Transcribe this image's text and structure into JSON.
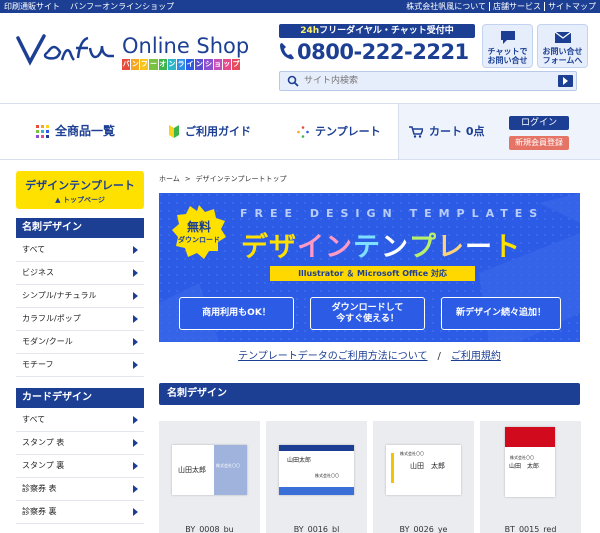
{
  "topbar": {
    "left": [
      "印刷通販サイト",
      "バンフーオンラインショップ"
    ],
    "right": [
      "株式会社帆風について",
      "店舗サービス",
      "サイトマップ"
    ]
  },
  "header": {
    "logo_text": "Vanfu",
    "shop_title": "Online Shop",
    "shop_sub": [
      "バ",
      "ン",
      "フ",
      "ー",
      "オ",
      "ン",
      "ラ",
      "イ",
      "ン",
      "シ",
      "ョ",
      "ッ",
      "プ"
    ],
    "phone_label_highlight": "24h",
    "phone_label_rest": "フリーダイヤル・チャット受付中",
    "phone_number": "0800-222-2221",
    "chat_button": "チャットで\nお問い合せ",
    "form_button": "お問い合せ\nフォームへ",
    "search_placeholder": "サイト内検索"
  },
  "nav": {
    "all_products": "全商品一覧",
    "guide": "ご利用ガイド",
    "template": "テンプレート",
    "cart": "カート 0点",
    "login": "ログイン",
    "register": "新規会員登録"
  },
  "sidebar": {
    "top_button_line1": "デザインテンプレート",
    "top_button_line2": "トップページ",
    "sections": [
      {
        "title": "名刺デザイン",
        "items": [
          "すべて",
          "ビジネス",
          "シンプル/ナチュラル",
          "カラフル/ポップ",
          "モダン/クール",
          "モチーフ"
        ]
      },
      {
        "title": "カードデザイン",
        "items": [
          "すべて",
          "スタンプ 表",
          "スタンプ 裏",
          "診察券 表",
          "診察券 裏"
        ]
      }
    ]
  },
  "main": {
    "breadcrumb": [
      "ホーム",
      "デザインテンプレートトップ"
    ],
    "hero": {
      "badge_line1": "無料",
      "badge_line2": "ダウンロード",
      "free_text": "FREE DESIGN TEMPLATES",
      "title_chars": [
        "デ",
        "ザ",
        "イ",
        "ン",
        "テ",
        "ン",
        "プ",
        "レ",
        "ー",
        "ト"
      ],
      "support": "Illustrator ＆ Microsoft Office 対応",
      "buttons": [
        "商用利用もOK！",
        "ダウンロードして\n今すぐ使える！",
        "新デザイン続々追加！"
      ]
    },
    "links": [
      "テンプレートデータのご利用方法について",
      "ご利用規約"
    ],
    "link_separator": "/",
    "section_title": "名刺デザイン",
    "cards": [
      {
        "code": "BY_0008_bu",
        "name": "山田太郎",
        "company": "株式会社〇〇"
      },
      {
        "code": "BY_0016_bl",
        "name": "山田太郎",
        "company": "株式会社〇〇"
      },
      {
        "code": "BY_0026_ye",
        "name": "山田　太郎",
        "company": "株式会社〇〇"
      },
      {
        "code": "BT_0015_red",
        "name": "山田　太郎",
        "company": "株式会社〇〇"
      }
    ]
  },
  "colors": {
    "brand_blue": "#1c3f94",
    "hero_blue": "#2c5ce6",
    "accent_yellow": "#ffe100",
    "register_red": "#e57467"
  }
}
